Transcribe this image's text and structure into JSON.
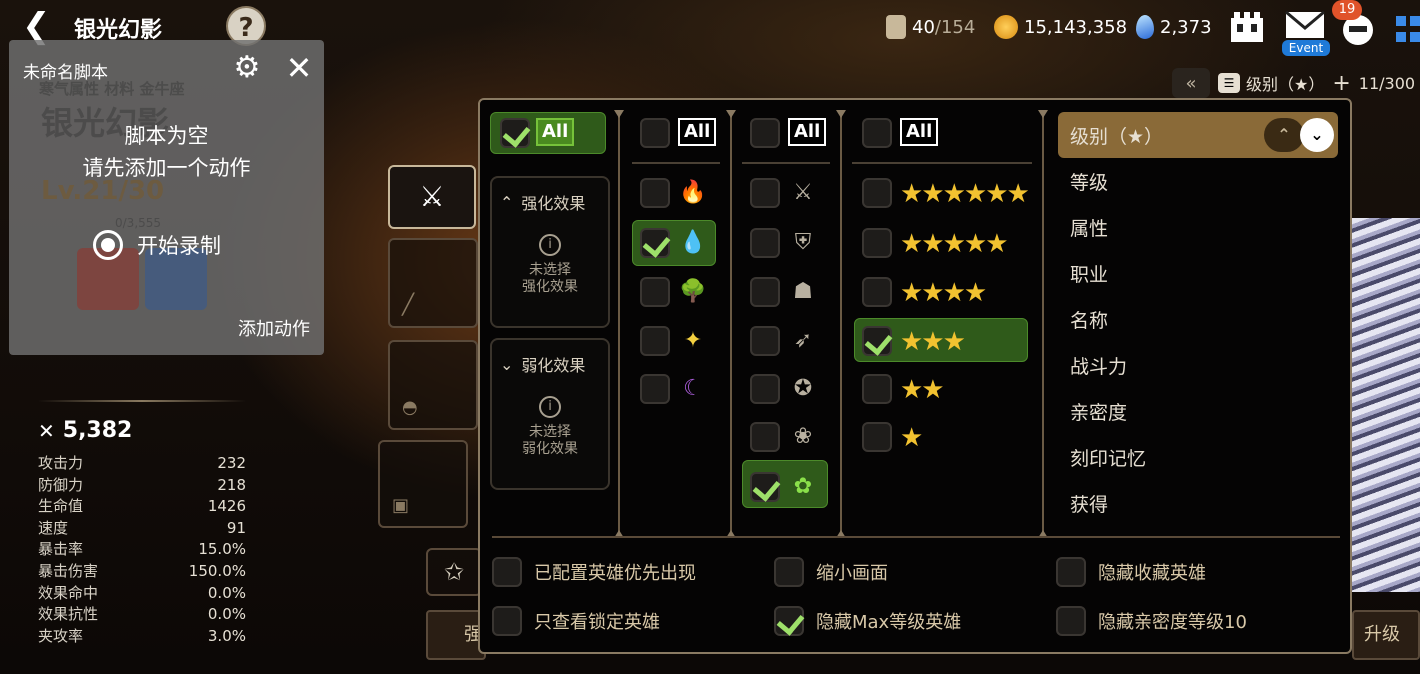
{
  "top": {
    "back_icon": "back-arrow-icon",
    "title": "银光幻影",
    "help": "?",
    "stamina": {
      "value": "40",
      "max": "/154"
    },
    "gold": "15,143,358",
    "crystal": "2,373",
    "mail_badge": "19",
    "event_label": "Event"
  },
  "sort_bar": {
    "collapse": "«",
    "sort_label": "级别（★）",
    "count": "11/300"
  },
  "script_panel": {
    "title": "未命名脚本",
    "empty_line1": "脚本为空",
    "empty_line2": "请先添加一个动作",
    "record": "开始录制",
    "add_action": "添加动作",
    "bg_name": "银光幻影",
    "bg_level": "Lv.21/30",
    "bg_exp": "0/3,555",
    "bg_tags": "寒气属性  材料  金牛座"
  },
  "stats": {
    "power": "5,382",
    "rows": [
      {
        "label": "攻击力",
        "value": "232"
      },
      {
        "label": "防御力",
        "value": "218"
      },
      {
        "label": "生命值",
        "value": "1426"
      },
      {
        "label": "速度",
        "value": "91"
      },
      {
        "label": "暴击率",
        "value": "15.0%"
      },
      {
        "label": "暴击伤害",
        "value": "150.0%"
      },
      {
        "label": "效果命中",
        "value": "0.0%"
      },
      {
        "label": "效果抗性",
        "value": "0.0%"
      },
      {
        "label": "夹攻率",
        "value": "3.0%"
      }
    ]
  },
  "filter": {
    "all": "All",
    "buff": {
      "title": "强化效果",
      "none": "未选择",
      "sub": "强化效果"
    },
    "debuff": {
      "title": "弱化效果",
      "none": "未选择",
      "sub": "弱化效果"
    },
    "elements": [
      {
        "name": "fire",
        "glyph": "🔥",
        "color": "#e84a2a",
        "checked": false
      },
      {
        "name": "ice",
        "glyph": "💧",
        "color": "#3aa8f0",
        "checked": true
      },
      {
        "name": "earth",
        "glyph": "🌳",
        "color": "#5ac04a",
        "checked": false
      },
      {
        "name": "light",
        "glyph": "✦",
        "color": "#f4d040",
        "checked": false
      },
      {
        "name": "dark",
        "glyph": "☾",
        "color": "#b060e0",
        "checked": false
      }
    ],
    "classes": [
      {
        "name": "warrior",
        "glyph": "⚔",
        "checked": false
      },
      {
        "name": "knight",
        "glyph": "⛨",
        "checked": false
      },
      {
        "name": "thief",
        "glyph": "☗",
        "checked": false
      },
      {
        "name": "ranger",
        "glyph": "➶",
        "checked": false
      },
      {
        "name": "mage",
        "glyph": "✪",
        "checked": false
      },
      {
        "name": "soul-weaver",
        "glyph": "❀",
        "checked": false
      },
      {
        "name": "material",
        "glyph": "✿",
        "checked": true
      }
    ],
    "stars": [
      {
        "count": 6,
        "glyph": "★★★★★★",
        "checked": false
      },
      {
        "count": 5,
        "glyph": "★★★★★",
        "checked": false
      },
      {
        "count": 4,
        "glyph": "★★★★",
        "checked": false
      },
      {
        "count": 3,
        "glyph": "★★★",
        "checked": true
      },
      {
        "count": 2,
        "glyph": "★★",
        "checked": false
      },
      {
        "count": 1,
        "glyph": "★",
        "checked": false
      }
    ],
    "sort_options": [
      "级别（★）",
      "等级",
      "属性",
      "职业",
      "名称",
      "战斗力",
      "亲密度",
      "刻印记忆",
      "获得"
    ],
    "options": [
      {
        "label": "已配置英雄优先出现",
        "checked": false
      },
      {
        "label": "缩小画面",
        "checked": false
      },
      {
        "label": "隐藏收藏英雄",
        "checked": false
      },
      {
        "label": "只查看锁定英雄",
        "checked": false
      },
      {
        "label": "隐藏Max等级英雄",
        "checked": true
      },
      {
        "label": "隐藏亲密度等级10",
        "checked": false
      }
    ]
  },
  "bottom": {
    "left_btn": "强",
    "right_btn": "升级"
  },
  "colors": {
    "accent_green": "#9ee06a",
    "gold_sel": "#8a6a38",
    "star": "#f2c230"
  }
}
